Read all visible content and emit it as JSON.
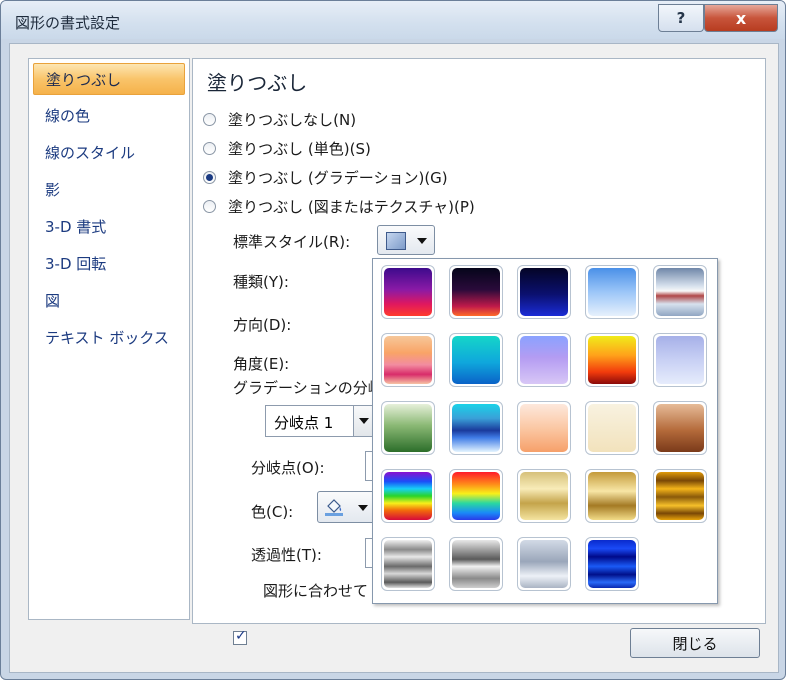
{
  "window": {
    "title": "図形の書式設定",
    "help_label": "?",
    "close_label": "x"
  },
  "sidebar": {
    "items": [
      {
        "label": "塗りつぶし",
        "selected": true
      },
      {
        "label": "線の色"
      },
      {
        "label": "線のスタイル"
      },
      {
        "label": "影"
      },
      {
        "label": "3-D 書式"
      },
      {
        "label": "3-D 回転"
      },
      {
        "label": "図"
      },
      {
        "label": "テキスト ボックス"
      }
    ]
  },
  "panel": {
    "heading": "塗りつぶし",
    "fill_options": [
      {
        "label": "塗りつぶしなし(N)",
        "checked": false
      },
      {
        "label": "塗りつぶし (単色)(S)",
        "checked": false
      },
      {
        "label": "塗りつぶし (グラデーション)(G)",
        "checked": true
      },
      {
        "label": "塗りつぶし (図またはテクスチャ)(P)",
        "checked": false
      }
    ],
    "preset_label": "標準スタイル(R):",
    "type_label": "種類(Y):",
    "direction_label": "方向(D):",
    "angle_label": "角度(E):",
    "stops_label": "グラデーションの分岐",
    "stop_select_value": "分岐点 1",
    "stop_position_label": "分岐点(O):",
    "color_label": "色(C):",
    "transparency_label": "透過性(T):",
    "rotate_label": "図形に合わせて"
  },
  "footer": {
    "close_label": "閉じる"
  },
  "gallery": {
    "swatches": [
      "linear-gradient(#3d0a8c,#8a1aa6 45%,#e0185f 75%,#ff3b2e)",
      "linear-gradient(#05051a,#2a0a3a 45%,#c01a4a 80%,#ff6b2a)",
      "linear-gradient(#040426,#0b1070 55%,#1a2cd6)",
      "linear-gradient(#4a90e8,#9cc6f8 50%,#e6f0fc)",
      "linear-gradient(#6f86a8,#d8e2ee 38%,#f8f8f8 48%,#b04848 58%,#d7e2ee 75%,#90a6c2)",
      "linear-gradient(#f6c79a,#f9a467 35%,#f28ca0 60%,#d82c6a 80%,#f7c4a5)",
      "linear-gradient(#15d6c8,#0fa7dc 55%,#0a62c8)",
      "linear-gradient(#8aa2ff,#b49cf2 45%,#d8c7f6)",
      "linear-gradient(#f0ec1a,#ffa21a 40%,#f23b0c 75%,#8a0a0a)",
      "linear-gradient(#a6b0e8,#c8d0f4 50%,#e6ecfc)",
      "linear-gradient(#e6f0da,#8ab874 45%,#2c6e2a)",
      "linear-gradient(#1ad2e8,#3aa0d8 30%,#1a3a9c 55%,#3f7be6 70%,#e4f4ff)",
      "linear-gradient(#fde8dc,#fbc8a4 50%,#f6a06a)",
      "linear-gradient(#f8f2e0,#f2e2bc)",
      "linear-gradient(#e6bb98,#b46a3a 55%,#7a3a1a)",
      "linear-gradient(#8a10d0,#1a50f8 20%,#17d0f6 35%,#2ad42a 50%,#f6f01a 65%,#f26a0a 80%,#d60a3a)",
      "linear-gradient(#ff1a2a,#ff8a1a 25%,#f8f01a 45%,#2ad8a0 65%,#1a8af8 85%,#2a3ae8)",
      "linear-gradient(#d6c07a,#f8ecb8 35%,#c4a44a 65%,#f4e4a0)",
      "linear-gradient(#c49a3a,#f8e6a6 40%,#a47a24 70%,#f2dc88)",
      "linear-gradient(#e09a0a,#7a4806 18%,#f4b41a 35%,#8a5a0a 52%,#f6c02a 70%,#7a4806 86%,#e6a20a)",
      "linear-gradient(#f0f0f0,#8a8a8a 20%,#e8e8e8 35%,#6a6a6a 55%,#d8d8d8 70%,#5a5a5a 88%,#e0e0e0)",
      "linear-gradient(#e8e8e8,#5a5a5a 40%,#f2f2f2 55%,#8a8a8a 80%,#cfcfcf)",
      "linear-gradient(#d2dae6,#9aa6ba 45%,#edf1f7 75%,#aab4c4)",
      "linear-gradient(#0a2acc,#1a4af6 18%,#000a8a 35%,#1a5af6 55%,#00108a 72%,#2a6af8 88%,#0a28b0)"
    ]
  }
}
